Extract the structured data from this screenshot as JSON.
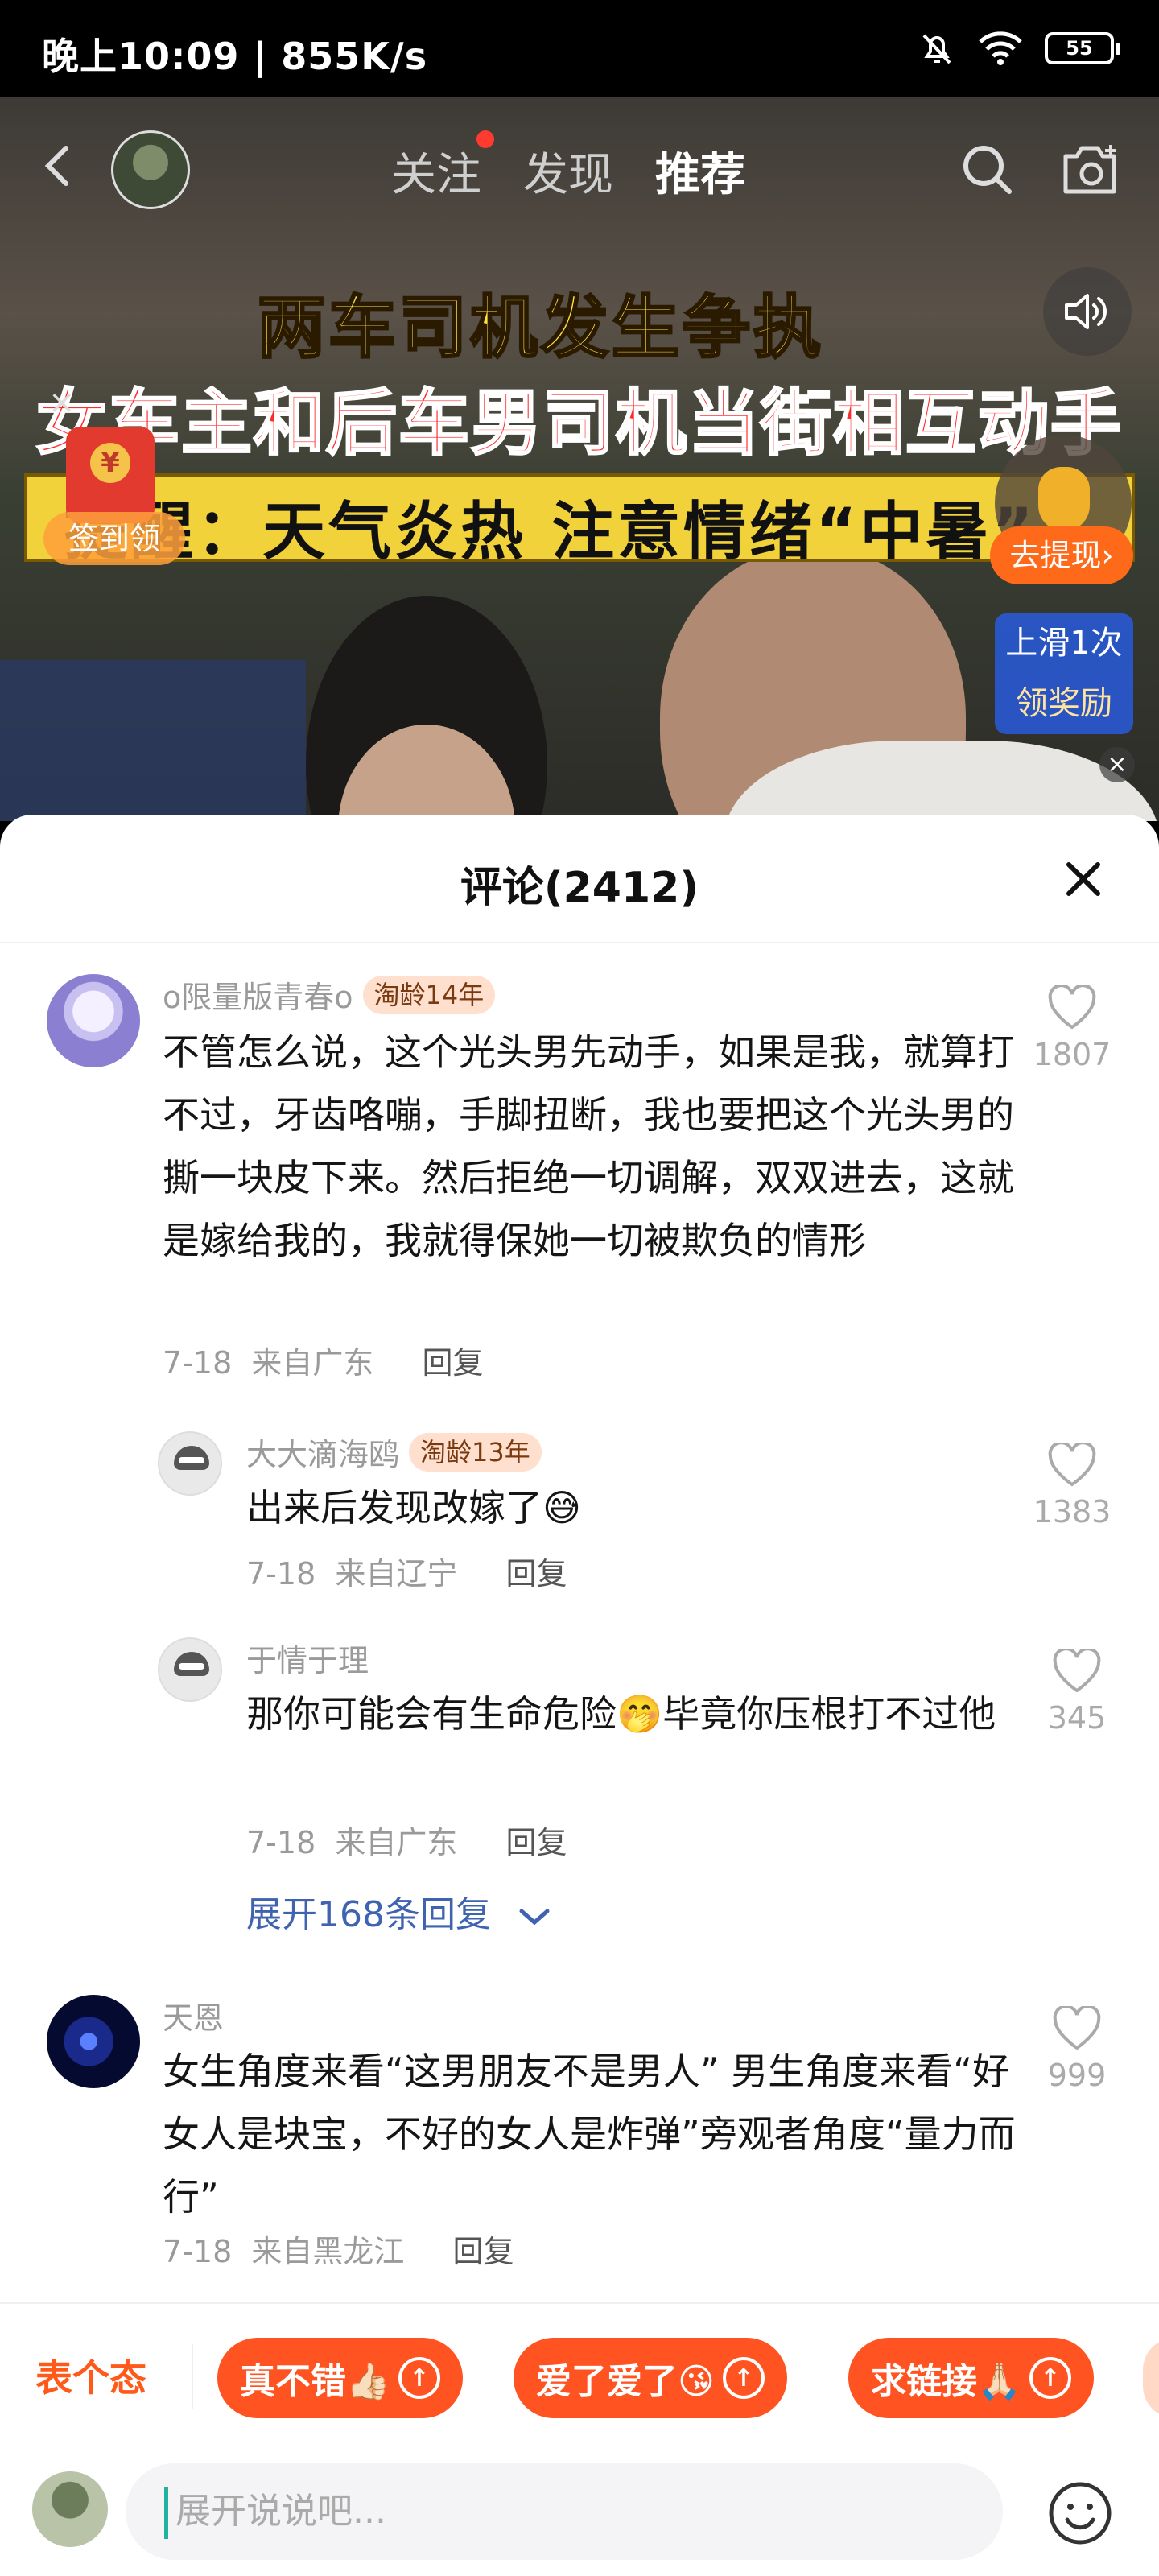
{
  "status_bar": {
    "time": "晚上10:09 | 855K/s",
    "battery": "55"
  },
  "top_nav": {
    "tabs": [
      "关注",
      "发现",
      "推荐"
    ],
    "active_tab": "推荐"
  },
  "video": {
    "caption_line1": "两车司机发生争执",
    "caption_line2": "女车主和后车男司机当街相互动手",
    "caption_line3": "提醒：天气炎热 注意情绪“中暑”",
    "signin_label": "签到领",
    "withdraw_label": "去提现",
    "reward_line1": "上滑1次",
    "reward_line2": "领奖励"
  },
  "comments_sheet": {
    "title": "评论(2412)",
    "comments": [
      {
        "user": "o限量版青春o",
        "badge": "淘龄14年",
        "text": "不管怎么说，这个光头男先动手，如果是我，就算打不过，牙齿咯嘣，手脚扭断，我也要把这个光头男的撕一块皮下来。然后拒绝一切调解，双双进去，这就是嫁给我的，我就得保她一切被欺负的情形",
        "date": "7-18",
        "location": "来自广东",
        "reply": "回复",
        "likes": "1807"
      },
      {
        "user": "大大滴海鸥",
        "badge": "淘龄13年",
        "text": "出来后发现改嫁了😅",
        "date": "7-18",
        "location": "来自辽宁",
        "reply": "回复",
        "likes": "1383"
      },
      {
        "user": "于情于理",
        "badge": "",
        "text": "那你可能会有生命危险🤭毕竟你压根打不过他",
        "date": "7-18",
        "location": "来自广东",
        "reply": "回复",
        "likes": "345"
      },
      {
        "user": "天恩",
        "badge": "",
        "text": "女生角度来看“这男朋友不是男人” 男生角度来看“好女人是块宝，不好的女人是炸弹”旁观者角度“量力而行”",
        "date": "7-18",
        "location": "来自黑龙江",
        "reply": "回复",
        "likes": "999"
      }
    ],
    "expand_label": "展开168条回复"
  },
  "quick_bar": {
    "label": "表个态",
    "chips": [
      "真不错👍🏻",
      "爱了爱了😘",
      "求链接🙏🏻"
    ]
  },
  "input_bar": {
    "placeholder": "展开说说吧..."
  },
  "colors": {
    "accent": "#ff5321",
    "badge_bg": "#ffe0cf",
    "link": "#3f63b0"
  }
}
